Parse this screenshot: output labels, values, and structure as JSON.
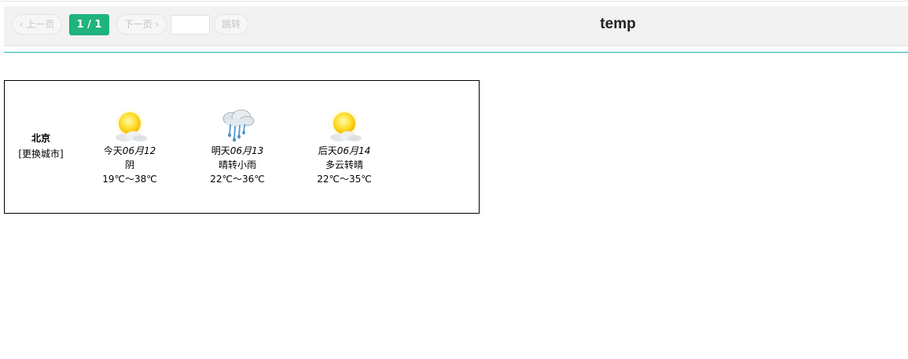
{
  "toolbar": {
    "prev_label": "‹ 上一页",
    "page_indicator": "1 / 1",
    "next_label": "下一页 ›",
    "page_input_value": "",
    "go_label": "跳转",
    "title": "temp"
  },
  "weather": {
    "city": "北京",
    "change_city_label": "[更换城市]",
    "days": [
      {
        "day": "今天",
        "date": "06月12",
        "condition": "阴",
        "temp_range": "19℃～38℃",
        "icon": "sun-cloud-icon"
      },
      {
        "day": "明天",
        "date": "06月13",
        "condition": "晴转小雨",
        "temp_range": "22℃～36℃",
        "icon": "rain-icon"
      },
      {
        "day": "后天",
        "date": "06月14",
        "condition": "多云转晴",
        "temp_range": "22℃～35℃",
        "icon": "sun-cloud-icon"
      }
    ]
  },
  "colors": {
    "accent": "#1fb37d",
    "rule": "#20b3a0",
    "toolbar_bg": "#f2f2f2"
  }
}
